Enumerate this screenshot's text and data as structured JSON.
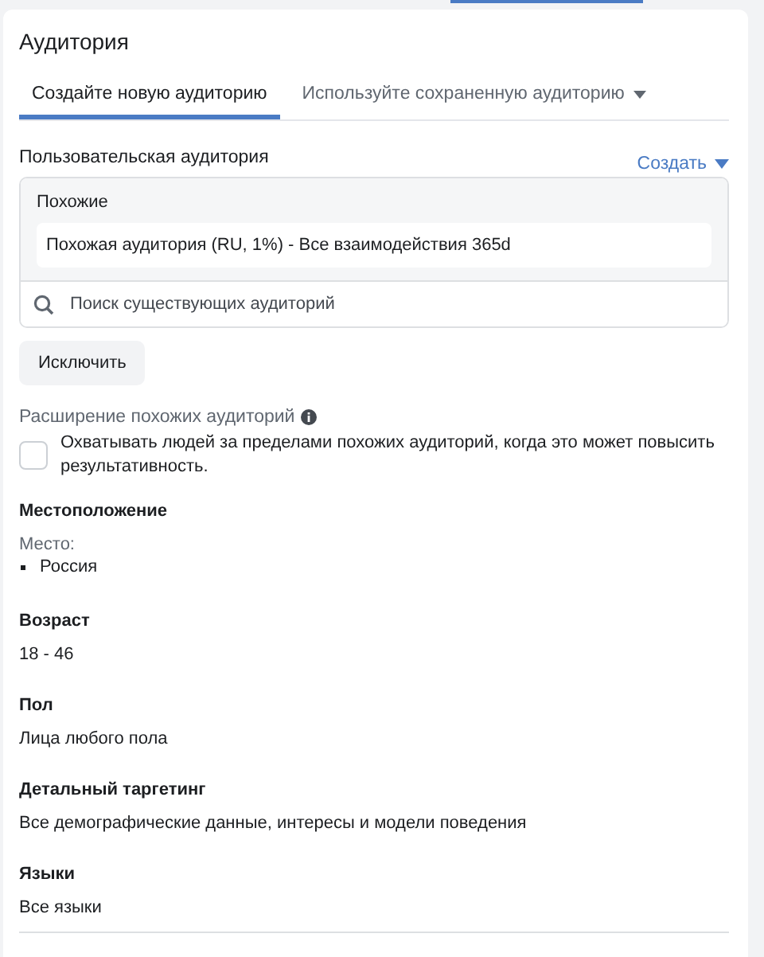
{
  "title": "Аудитория",
  "tabs": [
    {
      "label": "Создайте новую аудиторию",
      "selected": true,
      "dropdown": false
    },
    {
      "label": "Используйте сохраненную аудиторию",
      "selected": false,
      "dropdown": true
    }
  ],
  "custom_audience": {
    "label": "Пользовательская аудитория",
    "create_link": "Создать",
    "group_label": "Похожие",
    "chips": [
      "Похожая аудитория (RU, 1%) - Все взаимодействия 365d"
    ],
    "search": {
      "placeholder": "Поиск существующих аудиторий"
    },
    "exclude_button": "Исключить"
  },
  "expansion": {
    "label": "Расширение похожих аудиторий",
    "checked": false,
    "text": "Охватывать людей за пределами похожих аудиторий, когда это может повысить результативность."
  },
  "sections": [
    {
      "heading": "Местоположение",
      "sublabel": "Место:",
      "values": [
        "Россия"
      ],
      "kind": "list"
    },
    {
      "heading": "Возраст",
      "values": [
        "18 - 46"
      ],
      "kind": "plain"
    },
    {
      "heading": "Пол",
      "values": [
        "Лица любого пола"
      ],
      "kind": "plain"
    },
    {
      "heading": "Детальный таргетинг",
      "values": [
        "Все демографические данные, интересы и модели поведения"
      ],
      "kind": "plain"
    },
    {
      "heading": "Языки",
      "values": [
        "Все языки"
      ],
      "kind": "plain"
    }
  ]
}
